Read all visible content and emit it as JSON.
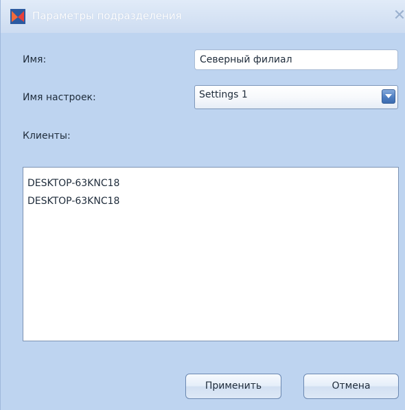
{
  "window": {
    "title": "Параметры подразделения",
    "close_glyph": "✕",
    "app_icon": "app-logo-icon"
  },
  "form": {
    "name_label": "Имя:",
    "name_value": "Северный филиал",
    "settings_label": "Имя настроек:",
    "settings_value": "Settings 1",
    "clients_label": "Клиенты:"
  },
  "clients": [
    "DESKTOP-63KNC18",
    "DESKTOP-63KNC18"
  ],
  "buttons": {
    "apply": "Применить",
    "cancel": "Отмена"
  },
  "colors": {
    "background": "#bed4f0",
    "accent": "#4f7fc2"
  }
}
